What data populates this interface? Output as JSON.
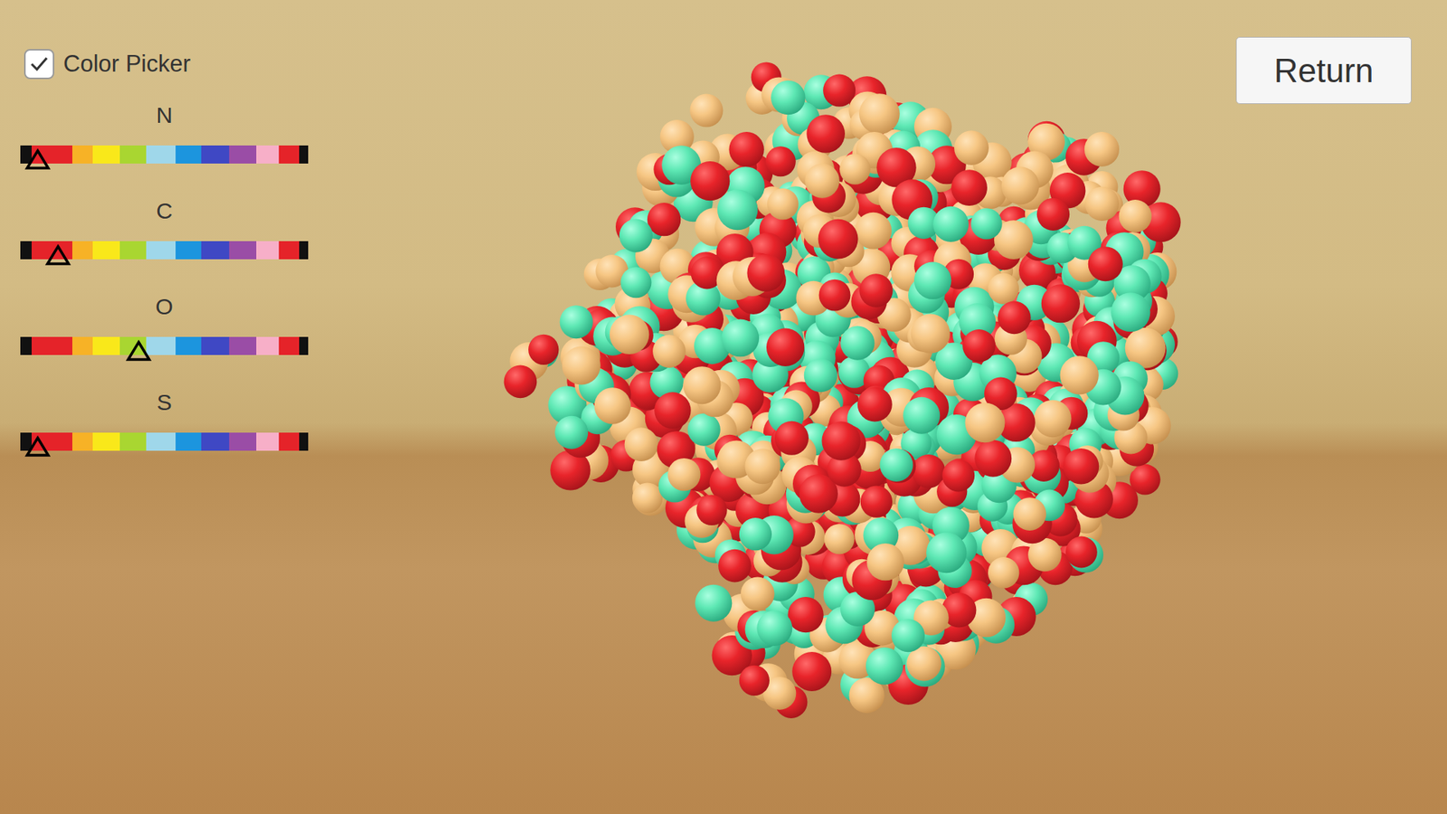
{
  "color_picker": {
    "label": "Color Picker",
    "checked": true
  },
  "sliders": [
    {
      "label": "N",
      "level": 0.06
    },
    {
      "label": "C",
      "level": 0.13
    },
    {
      "label": "O",
      "level": 0.41
    },
    {
      "label": "S",
      "level": 0.06
    }
  ],
  "buttons": [
    "Return"
  ]
}
